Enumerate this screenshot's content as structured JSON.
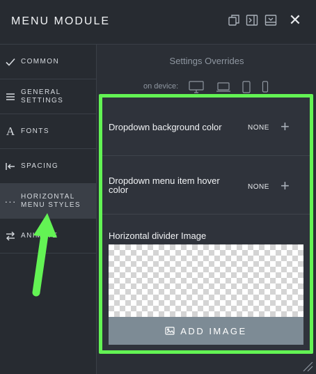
{
  "header": {
    "title": "MENU MODULE",
    "icons": [
      "duplicate-icon",
      "split-view-icon",
      "dock-icon"
    ],
    "close_icon": "close-icon"
  },
  "sidebar": {
    "items": [
      {
        "label": "COMMON",
        "icon": "check-icon"
      },
      {
        "label": "GENERAL\nSETTINGS",
        "icon": "hamburger-icon"
      },
      {
        "label": "FONTS",
        "icon": "font-icon"
      },
      {
        "label": "SPACING",
        "icon": "spacing-icon"
      },
      {
        "label": "HORIZONTAL\nMENU STYLES",
        "icon": "dots-icon",
        "active": true
      },
      {
        "label": "ANIMATE",
        "icon": "animate-icon"
      }
    ]
  },
  "main": {
    "section_title": "Settings Overrides",
    "on_device_label": "on device:",
    "device_icons": [
      "desktop-icon",
      "laptop-icon",
      "tablet-icon",
      "phone-icon"
    ],
    "settings": [
      {
        "label": "Dropdown background color",
        "value": "NONE"
      },
      {
        "label": "Dropdown menu item hover\ncolor",
        "value": "NONE"
      }
    ],
    "divider_image_label": "Horizontal divider Image",
    "add_image_label": "ADD IMAGE"
  },
  "annotation": {
    "highlight_color": "#63f354"
  }
}
